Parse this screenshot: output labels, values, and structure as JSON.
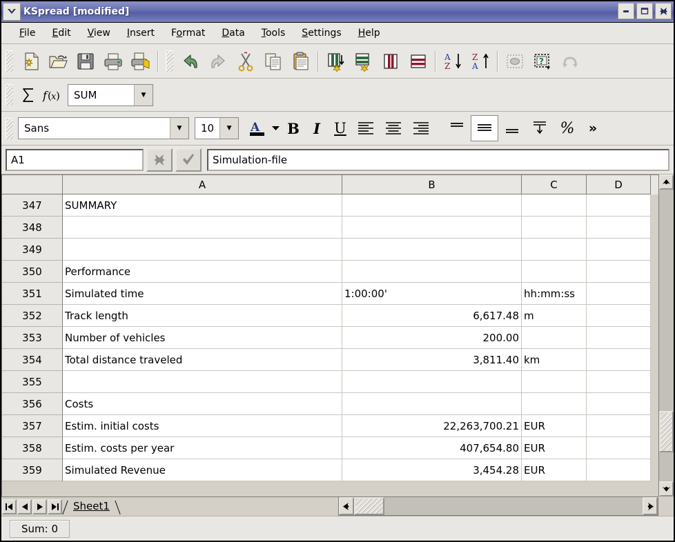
{
  "window": {
    "title": "KSpread [modified]",
    "title_menu_icon": "chevron-down-icon",
    "buttons": {
      "minimize": "minimize-icon",
      "maximize": "maximize-icon",
      "close": "close-icon"
    },
    "colors": {
      "titlebar": "#666fb0",
      "chrome": "#e9e7e3",
      "grid_line": "#c9c6bf",
      "header": "#e9e7e3"
    }
  },
  "menubar": {
    "items": [
      {
        "label": "File",
        "accel": "F"
      },
      {
        "label": "Edit",
        "accel": "E"
      },
      {
        "label": "View",
        "accel": "V"
      },
      {
        "label": "Insert",
        "accel": "I"
      },
      {
        "label": "Format",
        "accel": "o"
      },
      {
        "label": "Data",
        "accel": "D"
      },
      {
        "label": "Tools",
        "accel": "T"
      },
      {
        "label": "Settings",
        "accel": "S"
      },
      {
        "label": "Help",
        "accel": "H"
      }
    ]
  },
  "toolbar_main": {
    "groups": [
      [
        "new-document-icon",
        "open-document-icon",
        "save-document-icon",
        "print-icon",
        "print-preview-icon"
      ],
      [
        "undo-icon",
        "redo-icon",
        "cut-icon",
        "copy-icon",
        "paste-icon"
      ],
      [
        "insert-column-icon",
        "insert-row-icon",
        "delete-column-icon",
        "delete-row-icon"
      ],
      [
        "sort-ascending-icon",
        "sort-descending-icon"
      ],
      [
        "insert-chart-icon",
        "whats-this-help-icon",
        "revert-icon"
      ]
    ]
  },
  "toolbar_formula": {
    "sum_icon": "sigma-sum-icon",
    "function_icon": "function-fx-icon",
    "function_selected": "SUM",
    "dropdown_icon": "chevron-down-icon"
  },
  "toolbar_format": {
    "font_name": "Sans",
    "font_size": "10",
    "text_color_icon": "text-color-icon",
    "text_color_dropdown_icon": "chevron-down-icon",
    "bold_label": "B",
    "italic_label": "I",
    "underline_label": "U",
    "align_left_icon": "align-left-icon",
    "align_center_icon": "align-center-icon",
    "align_right_icon": "align-right-icon",
    "valign_top_icon": "align-top-icon",
    "valign_middle_icon": "align-middle-icon",
    "valign_bottom_icon": "align-bottom-icon",
    "wrap_text_icon": "wrap-text-icon",
    "percent_label": "%",
    "overflow_label": "»"
  },
  "formula_bar": {
    "cell_reference": "A1",
    "cancel_icon": "cancel-x-icon",
    "accept_icon": "accept-check-icon",
    "content": "Simulation-file"
  },
  "sheet": {
    "columns": [
      "A",
      "B",
      "C",
      "D"
    ],
    "rows": [
      {
        "num": "347",
        "A": "SUMMARY",
        "B": "",
        "C": "",
        "D": ""
      },
      {
        "num": "348",
        "A": "",
        "B": "",
        "C": "",
        "D": ""
      },
      {
        "num": "349",
        "A": "",
        "B": "",
        "C": "",
        "D": ""
      },
      {
        "num": "350",
        "A": "Performance",
        "B": "",
        "C": "",
        "D": ""
      },
      {
        "num": "351",
        "A": "Simulated time",
        "B": "1:00:00'",
        "C": "hh:mm:ss",
        "D": ""
      },
      {
        "num": "352",
        "A": "Track length",
        "B": "6,617.48",
        "C": "m",
        "D": ""
      },
      {
        "num": "353",
        "A": "Number of vehicles",
        "B": "200.00",
        "C": "",
        "D": ""
      },
      {
        "num": "354",
        "A": "Total distance traveled",
        "B": "3,811.40",
        "C": "km",
        "D": ""
      },
      {
        "num": "355",
        "A": "",
        "B": "",
        "C": "",
        "D": ""
      },
      {
        "num": "356",
        "A": "Costs",
        "B": "",
        "C": "",
        "D": ""
      },
      {
        "num": "357",
        "A": "Estim. initial costs",
        "B": "22,263,700.21",
        "C": "EUR",
        "D": ""
      },
      {
        "num": "358",
        "A": "Estim. costs per year",
        "B": "407,654.80",
        "C": "EUR",
        "D": ""
      },
      {
        "num": "359",
        "A": "Simulated Revenue",
        "B": "3,454.28",
        "C": "EUR",
        "D": ""
      }
    ],
    "numeric_columns": [
      "B"
    ],
    "left_aligned_exceptions": {
      "351": "B"
    }
  },
  "sheet_tabs": {
    "first_icon": "go-first-icon",
    "prev_icon": "go-previous-icon",
    "next_icon": "go-next-icon",
    "last_icon": "go-last-icon",
    "tabs": [
      {
        "label": "Sheet1",
        "active": true
      }
    ]
  },
  "scrollbars": {
    "v_up_icon": "scroll-up-icon",
    "v_down_icon": "scroll-down-icon",
    "h_left_icon": "scroll-left-icon",
    "h_right_icon": "scroll-right-icon"
  },
  "statusbar": {
    "sum_label": "Sum: 0"
  }
}
